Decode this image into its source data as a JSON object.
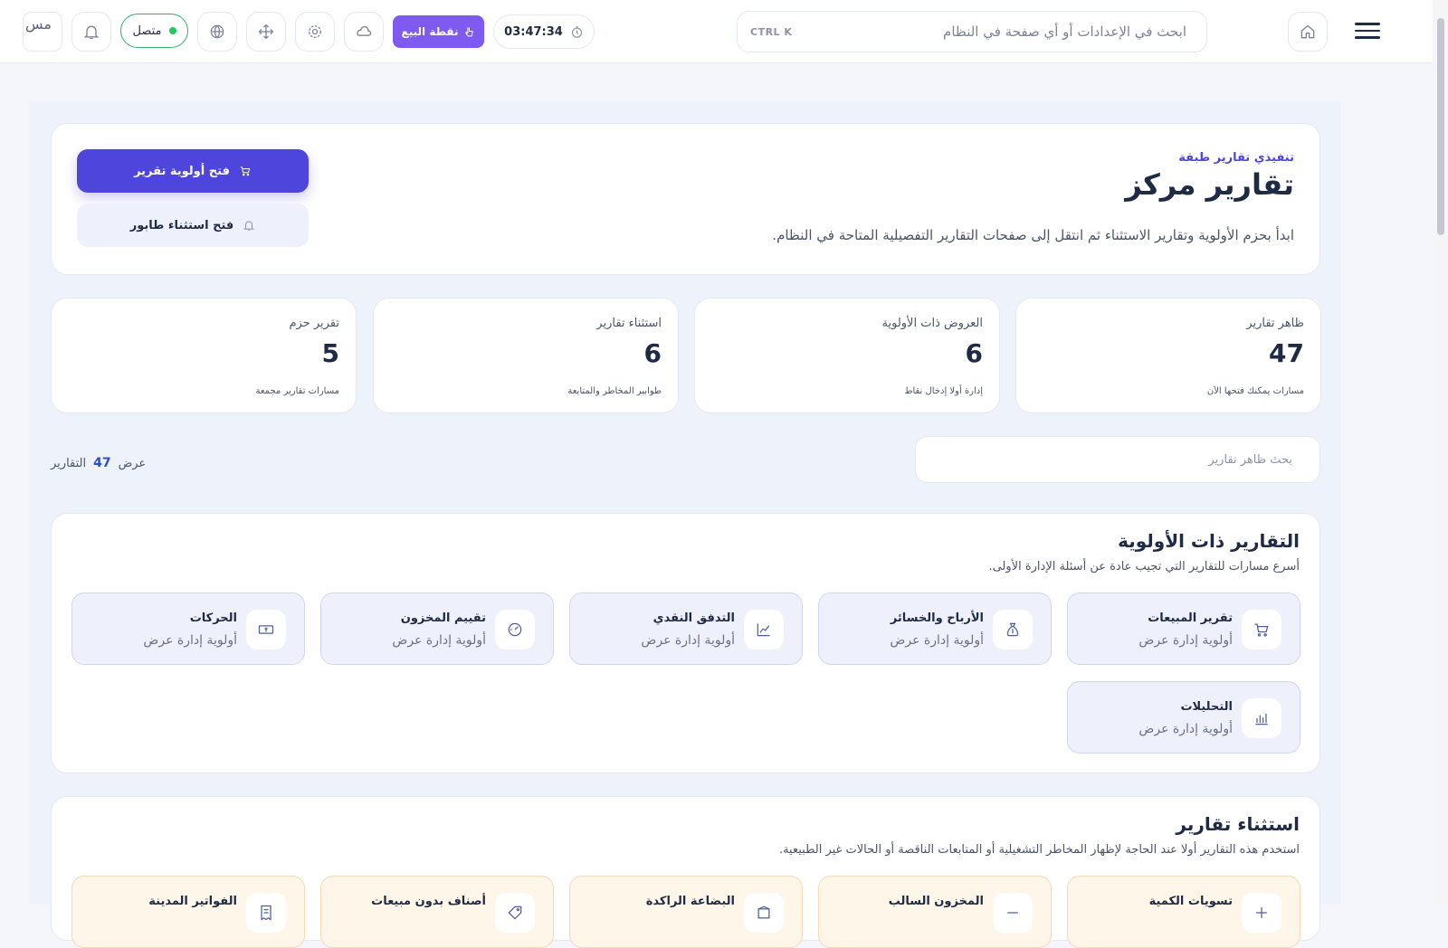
{
  "topbar": {
    "search_placeholder": "ابحث في الإعدادات أو أي صفحة في النظام",
    "search_shortcut": "CTRL K",
    "timer": "03:47:34",
    "pos_label": "نقطة البيع",
    "status_label": "متصل",
    "logo_alt": "مس"
  },
  "hero": {
    "eyebrow": "تنفيذي تقارير طبقة",
    "title": "تقارير مركز",
    "description": "ابدأ بحزم الأولوية وتقارير الاستثناء ثم انتقل إلى صفحات التقارير التفصيلية المتاحة في النظام.",
    "primary_button": "فتح أولوية تقرير",
    "secondary_button": "فتح استثناء طابور"
  },
  "stats": [
    {
      "label": "ظاهر تقارير",
      "value": "47",
      "sub": "مسارات يمكنك فتحها الآن"
    },
    {
      "label": "العروض ذات الأولوية",
      "value": "6",
      "sub": "إدارة أولا إدخال نقاط"
    },
    {
      "label": "استثناء تقارير",
      "value": "6",
      "sub": "طوابير المخاطر والمتابعة"
    },
    {
      "label": "تقرير حزم",
      "value": "5",
      "sub": "مسارات تقارير مجمعة"
    }
  ],
  "filter": {
    "search_placeholder": "بحث ظاهر تقارير",
    "count_prefix": "عرض",
    "count_value": "47",
    "count_suffix": "التقارير"
  },
  "priority": {
    "title": "التقارير ذات الأولوية",
    "description": "أسرع مسارات للتقارير التي تجيب عادة عن أسئلة الإدارة الأولى.",
    "tiles": [
      {
        "title": "تقرير المبيعات",
        "sub": "أولوية إدارة عرض"
      },
      {
        "title": "الأرباح والخسائر",
        "sub": "أولوية إدارة عرض"
      },
      {
        "title": "التدفق النقدي",
        "sub": "أولوية إدارة عرض"
      },
      {
        "title": "تقييم المخزون",
        "sub": "أولوية إدارة عرض"
      },
      {
        "title": "الحركات",
        "sub": "أولوية إدارة عرض"
      },
      {
        "title": "التحليلات",
        "sub": "أولوية إدارة عرض"
      }
    ]
  },
  "exceptions": {
    "title": "استثناء تقارير",
    "description": "استخدم هذه التقارير أولا عند الحاجة لإظهار المخاطر التشغيلية أو المتابعات الناقصة أو الحالات غير الطبيعية.",
    "tiles": [
      {
        "title": "تسويات الكمية"
      },
      {
        "title": "المخزون السالب"
      },
      {
        "title": "البضاعة الراكدة"
      },
      {
        "title": "أصناف بدون مبيعات"
      },
      {
        "title": "الفواتير المدينة"
      }
    ]
  }
}
